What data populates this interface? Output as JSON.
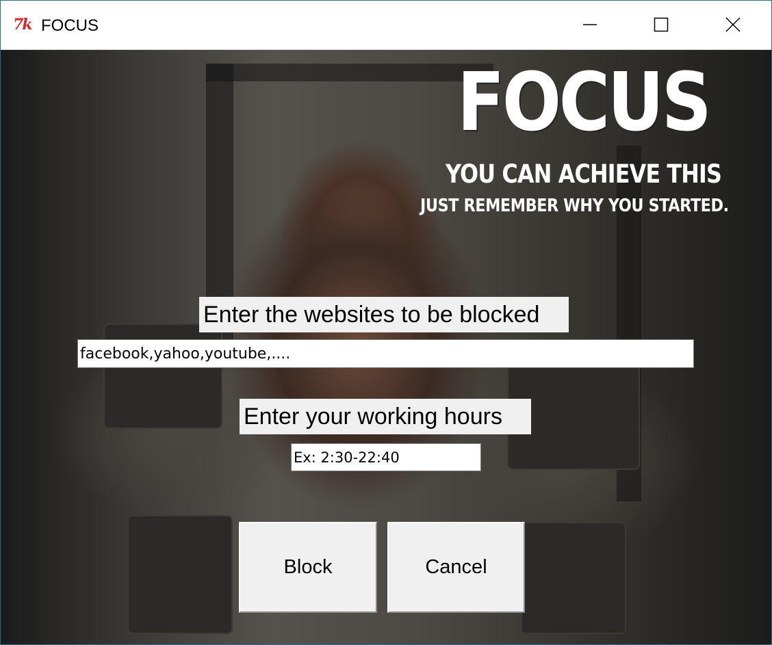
{
  "window": {
    "title": "FOCUS",
    "icon_text": "7k",
    "icon_name": "tk-feather-icon",
    "accent_color": "#d8262e",
    "controls": {
      "minimize": "minimize-icon",
      "maximize": "maximize-icon",
      "close": "close-icon"
    }
  },
  "poster": {
    "headline": "FOCUS",
    "line1": "YOU CAN ACHIEVE THIS",
    "line2": "JUST REMEMBER WHY YOU STARTED."
  },
  "form": {
    "sites_label": "Enter the websites to be blocked",
    "sites_value": "facebook,yahoo,youtube,....",
    "hours_label": "Enter your working hours",
    "hours_value": "Ex: 2:30-22:40",
    "block_label": "Block",
    "cancel_label": "Cancel"
  }
}
